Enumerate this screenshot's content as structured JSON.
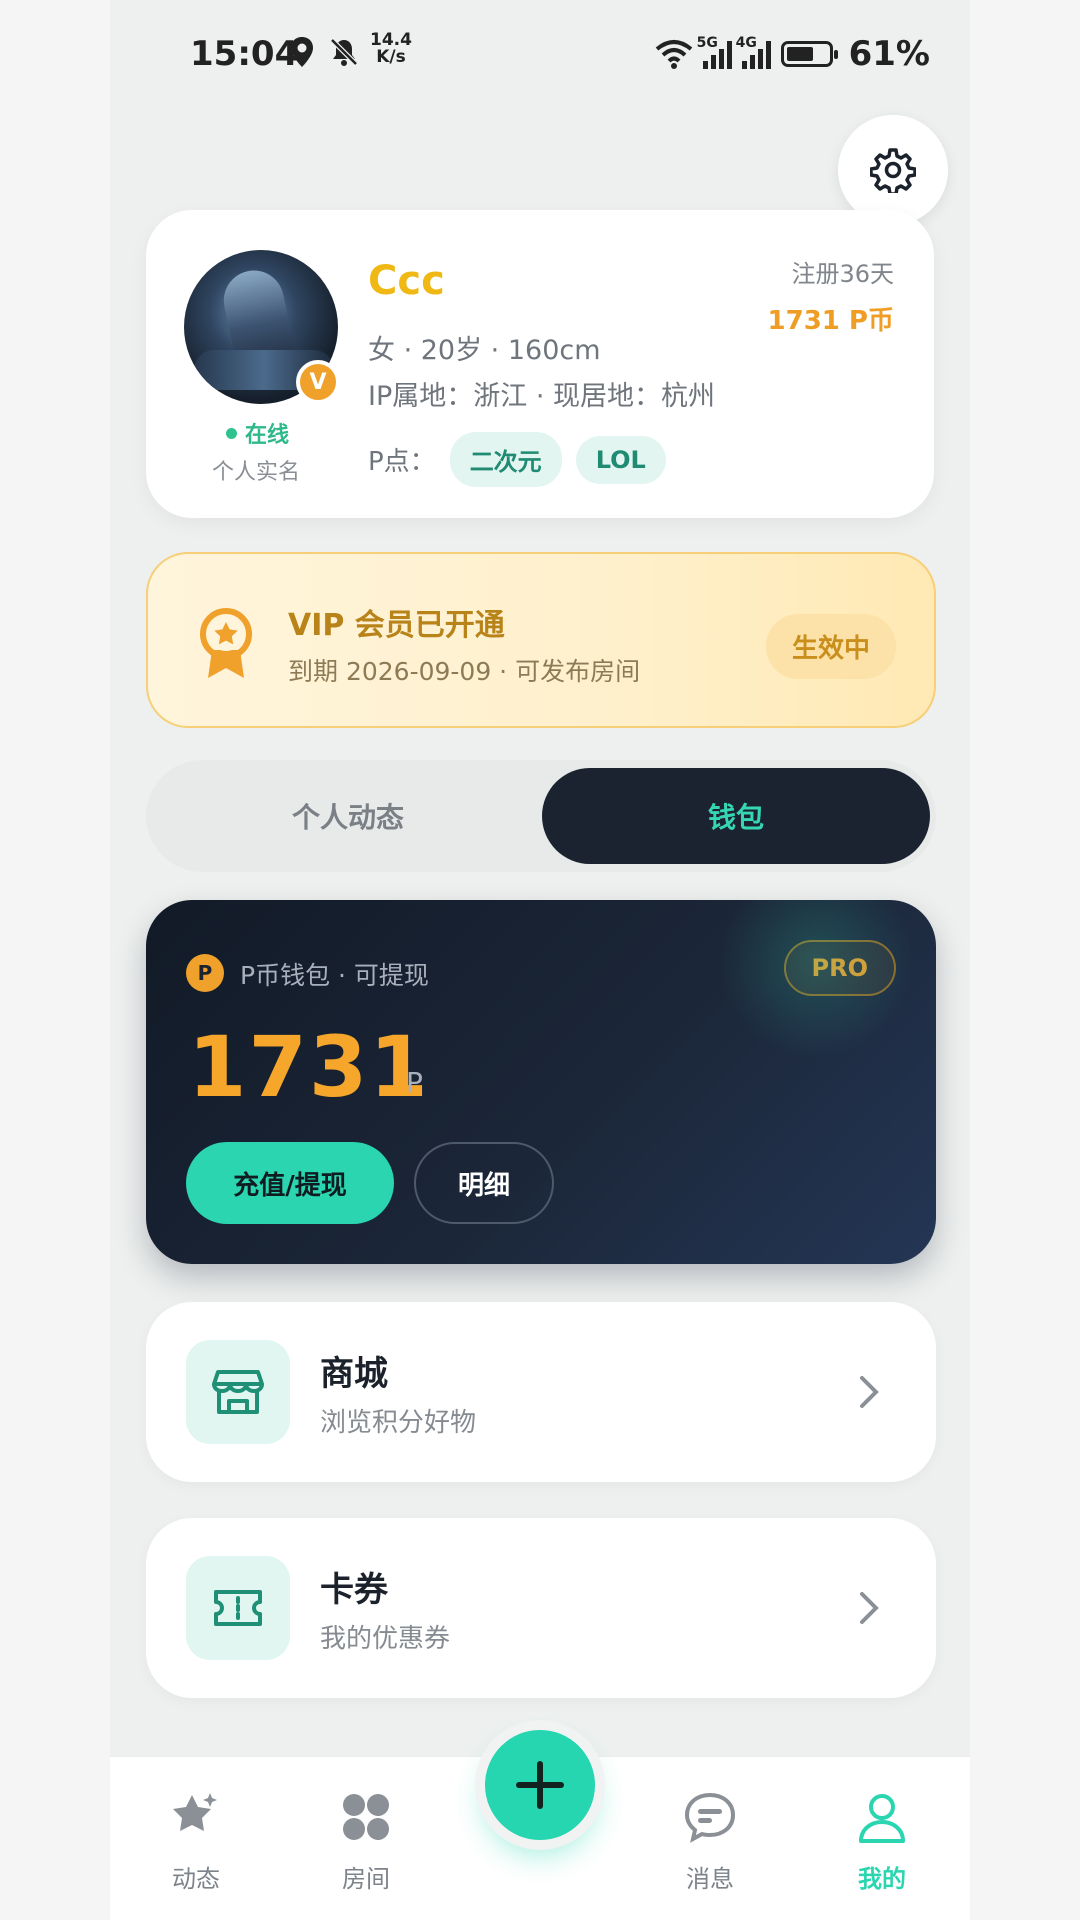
{
  "status_bar": {
    "time": "15:04",
    "net_speed_value": "14.4",
    "net_speed_unit": "K/s",
    "sig1_label": "5G",
    "sig2_label": "4G",
    "battery": "61%"
  },
  "profile": {
    "username": "Ccc",
    "basic_info": "女 · 20岁 · 160cm",
    "location_info": "IP属地：浙江 · 现居地：杭州",
    "online_status": "在线",
    "real_name": "个人实名",
    "badge": "V",
    "p_points_label": "P点：",
    "tags": [
      "二次元",
      "LOL"
    ],
    "register_days": "注册36天",
    "coins": "1731 P币"
  },
  "vip": {
    "title": "VIP 会员已开通",
    "subtitle": "到期 2026-09-09 · 可发布房间",
    "status": "生效中"
  },
  "tabs": [
    {
      "label": "个人动态"
    },
    {
      "label": "钱包"
    }
  ],
  "wallet": {
    "coin_symbol": "P",
    "label": "P币钱包 · 可提现",
    "pro": "PRO",
    "balance": "1731",
    "unit": "P",
    "recharge": "充值/提现",
    "detail": "明细"
  },
  "menu": [
    {
      "title": "商城",
      "subtitle": "浏览积分好物",
      "icon": "store-icon"
    },
    {
      "title": "卡券",
      "subtitle": "我的优惠券",
      "icon": "ticket-icon"
    }
  ],
  "bottom_nav": [
    {
      "label": "动态",
      "icon": "star-icon"
    },
    {
      "label": "房间",
      "icon": "grid-icon"
    },
    {
      "label": "消息",
      "icon": "message-icon"
    },
    {
      "label": "我的",
      "icon": "user-icon"
    }
  ],
  "colors": {
    "accent": "#2ad5b0",
    "gold": "#f5a62b",
    "dark": "#1b2330"
  }
}
